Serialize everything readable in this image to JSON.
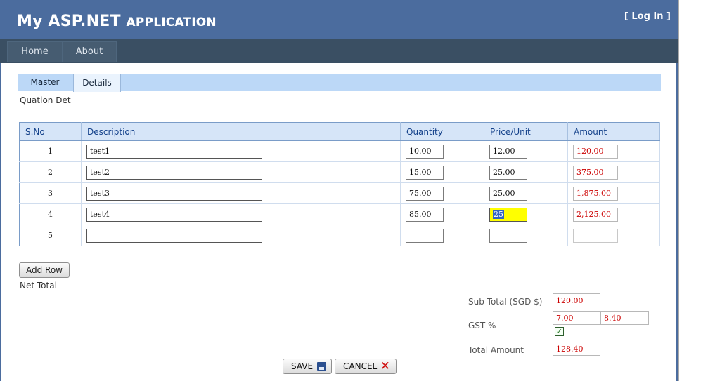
{
  "app": {
    "title_main": "My ASP.NET ",
    "title_sc": "Application",
    "login_prefix": "[ ",
    "login_label": "Log In",
    "login_suffix": " ]"
  },
  "menu": [
    {
      "label": "Home"
    },
    {
      "label": "About"
    }
  ],
  "tabs": [
    {
      "label": "Master"
    },
    {
      "label": "Details"
    }
  ],
  "section_label": "Quation Det",
  "grid": {
    "headers": {
      "sno": "S.No",
      "description": "Description",
      "quantity": "Quantity",
      "price": "Price/Unit",
      "amount": "Amount"
    },
    "rows": [
      {
        "sno": "1",
        "description": "test1",
        "quantity": "10.00",
        "price": "12.00",
        "amount": "120.00"
      },
      {
        "sno": "2",
        "description": "test2",
        "quantity": "15.00",
        "price": "25.00",
        "amount": "375.00"
      },
      {
        "sno": "3",
        "description": "test3",
        "quantity": "75.00",
        "price": "25.00",
        "amount": "1,875.00"
      },
      {
        "sno": "4",
        "description": "test4",
        "quantity": "85.00",
        "price": "25",
        "amount": "2,125.00"
      },
      {
        "sno": "5",
        "description": "",
        "quantity": "",
        "price": "",
        "amount": ""
      }
    ]
  },
  "add_row_label": "Add Row",
  "net_total_label": "Net Total",
  "totals": {
    "subtotal_label": "Sub Total (SGD $)",
    "subtotal_value": "120.00",
    "gst_label": "GST %",
    "gst_rate": "7.00",
    "gst_amount": "8.40",
    "gst_checked": true,
    "total_label": "Total Amount",
    "total_value": "128.40"
  },
  "buttons": {
    "save_label": "SAVE",
    "cancel_label": "CANCEL"
  },
  "colors": {
    "header_bg": "#4b6c9e",
    "menu_bg": "#3a4f63",
    "amount_text": "#cc0000",
    "highlight_field": "#ffff00"
  }
}
